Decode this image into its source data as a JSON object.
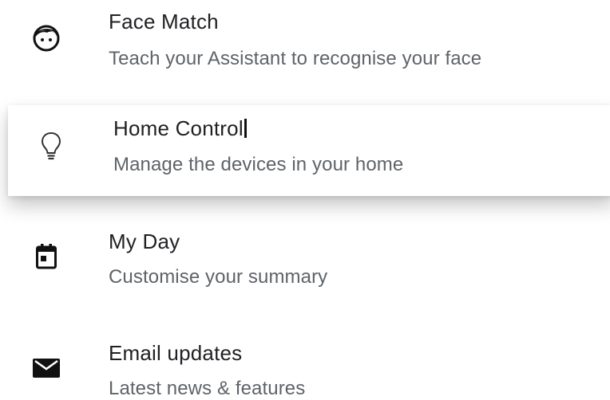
{
  "settings": {
    "items": [
      {
        "title": "Face Match",
        "subtitle": "Teach your Assistant to recognise your face",
        "icon": "face-icon"
      },
      {
        "title": "Home Control",
        "subtitle": "Manage the devices in your home",
        "icon": "lightbulb-icon"
      },
      {
        "title": "My Day",
        "subtitle": "Customise your summary",
        "icon": "calendar-icon"
      },
      {
        "title": "Email updates",
        "subtitle": "Latest news & features",
        "icon": "mail-icon"
      }
    ]
  },
  "colors": {
    "title": "#202124",
    "subtitle": "#5f6368",
    "icon": "#111111",
    "background": "#ffffff"
  }
}
